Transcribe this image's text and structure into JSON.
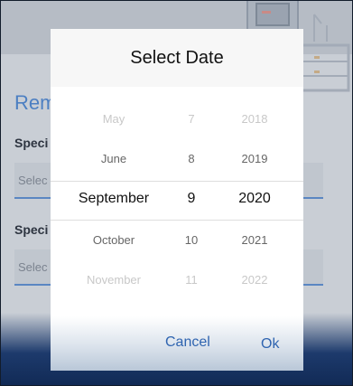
{
  "background": {
    "title": "Rem",
    "field1_label": "Speci",
    "field1_placeholder": "Selec",
    "field2_label": "Speci",
    "field2_placeholder": "Selec"
  },
  "dialog": {
    "title": "Select Date",
    "cancel_label": "Cancel",
    "ok_label": "Ok"
  },
  "picker": {
    "months": [
      "May",
      "June",
      "September",
      "October",
      "November"
    ],
    "days": [
      "7",
      "8",
      "9",
      "10",
      "11"
    ],
    "years": [
      "2018",
      "2019",
      "2020",
      "2021",
      "2022"
    ],
    "selected_index": 2
  },
  "colors": {
    "accent": "#2f64b0",
    "selected_text": "#111111",
    "faded_text": "#c8c8c8",
    "mid_text": "#666666"
  }
}
